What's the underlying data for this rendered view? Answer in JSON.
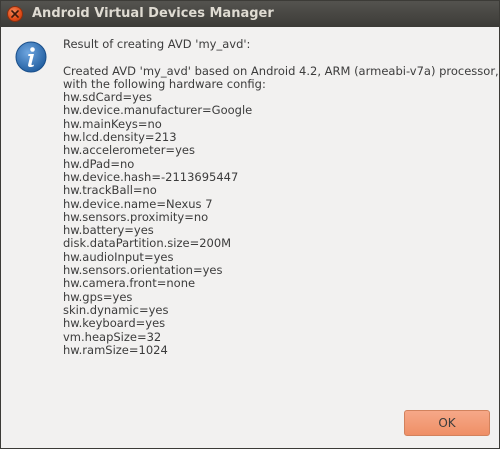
{
  "window": {
    "title": "Android Virtual Devices Manager"
  },
  "dialog": {
    "icon": "info-icon",
    "heading": "Result of creating AVD 'my_avd':",
    "intro_line1": "Created AVD 'my_avd' based on Android 4.2, ARM (armeabi-v7a) processor,",
    "intro_line2": "with the following hardware config:",
    "config": [
      "hw.sdCard=yes",
      "hw.device.manufacturer=Google",
      "hw.mainKeys=no",
      "hw.lcd.density=213",
      "hw.accelerometer=yes",
      "hw.dPad=no",
      "hw.device.hash=-2113695447",
      "hw.trackBall=no",
      "hw.device.name=Nexus 7",
      "hw.sensors.proximity=no",
      "hw.battery=yes",
      "disk.dataPartition.size=200M",
      "hw.audioInput=yes",
      "hw.sensors.orientation=yes",
      "hw.camera.front=none",
      "hw.gps=yes",
      "skin.dynamic=yes",
      "hw.keyboard=yes",
      "vm.heapSize=32",
      "hw.ramSize=1024"
    ],
    "ok_label": "OK"
  },
  "colors": {
    "titlebar": "#3c3b37",
    "close_button": "#df4a16",
    "ok_button": "#ef8f66",
    "background": "#f2f1f0",
    "info_icon": "#2d6cb0"
  }
}
